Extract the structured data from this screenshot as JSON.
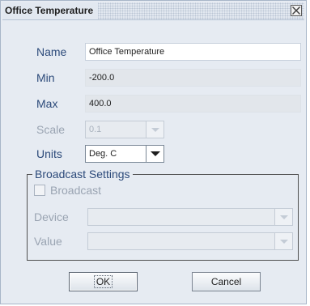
{
  "window": {
    "title": "Office Temperature"
  },
  "form": {
    "name_label": "Name",
    "name_value": "Office Temperature",
    "min_label": "Min",
    "min_value": "-200.0",
    "max_label": "Max",
    "max_value": "400.0",
    "scale_label": "Scale",
    "scale_value": "0.1",
    "units_label": "Units",
    "units_value": "Deg. C"
  },
  "broadcast": {
    "group_title": "Broadcast Settings",
    "checkbox_label": "Broadcast",
    "checkbox_checked": false,
    "device_label": "Device",
    "device_value": "",
    "value_label": "Value",
    "value_value": ""
  },
  "buttons": {
    "ok_label": "OK",
    "cancel_label": "Cancel"
  },
  "icons": {
    "close": "close-icon",
    "dropdown": "chevron-down-icon"
  },
  "colors": {
    "label_text": "#2c4a7a",
    "disabled_text": "#9aa4b2",
    "dialog_background": "#e6ebf2"
  }
}
